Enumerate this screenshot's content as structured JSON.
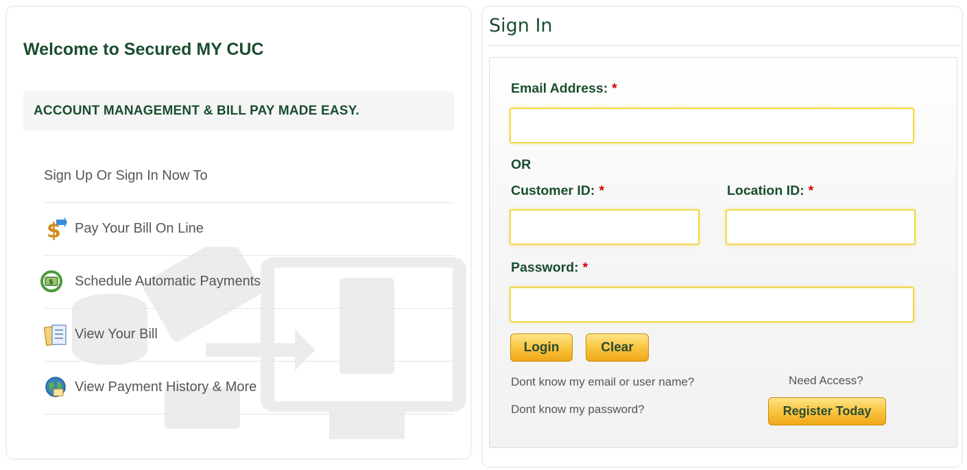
{
  "left": {
    "title": "Welcome to Secured MY CUC",
    "tagline": "ACCOUNT MANAGEMENT & BILL PAY MADE EASY.",
    "intro": "Sign Up Or Sign In Now To",
    "features": [
      {
        "label": "Pay Your Bill On Line",
        "icon": "dollar-arrow-icon"
      },
      {
        "label": "Schedule Automatic Payments",
        "icon": "recurring-money-icon"
      },
      {
        "label": "View Your Bill",
        "icon": "bill-document-icon"
      },
      {
        "label": "View Payment History & More",
        "icon": "globe-history-icon"
      }
    ]
  },
  "signin": {
    "title": "Sign In",
    "email_label": "Email Address:",
    "or_text": "OR",
    "customer_id_label": "Customer ID:",
    "location_id_label": "Location ID:",
    "password_label": "Password:",
    "required_mark": "*",
    "email_value": "",
    "customer_id_value": "",
    "location_id_value": "",
    "password_value": "",
    "login_label": "Login",
    "clear_label": "Clear",
    "forgot_username": "Dont know my email or user name?",
    "forgot_password": "Dont know my password?",
    "need_access": "Need Access?",
    "register_label": "Register Today"
  },
  "colors": {
    "heading_green": "#1a4d2e",
    "required_red": "#d40000",
    "button_gold": "#f9c53f",
    "input_border": "#f2d64b"
  }
}
